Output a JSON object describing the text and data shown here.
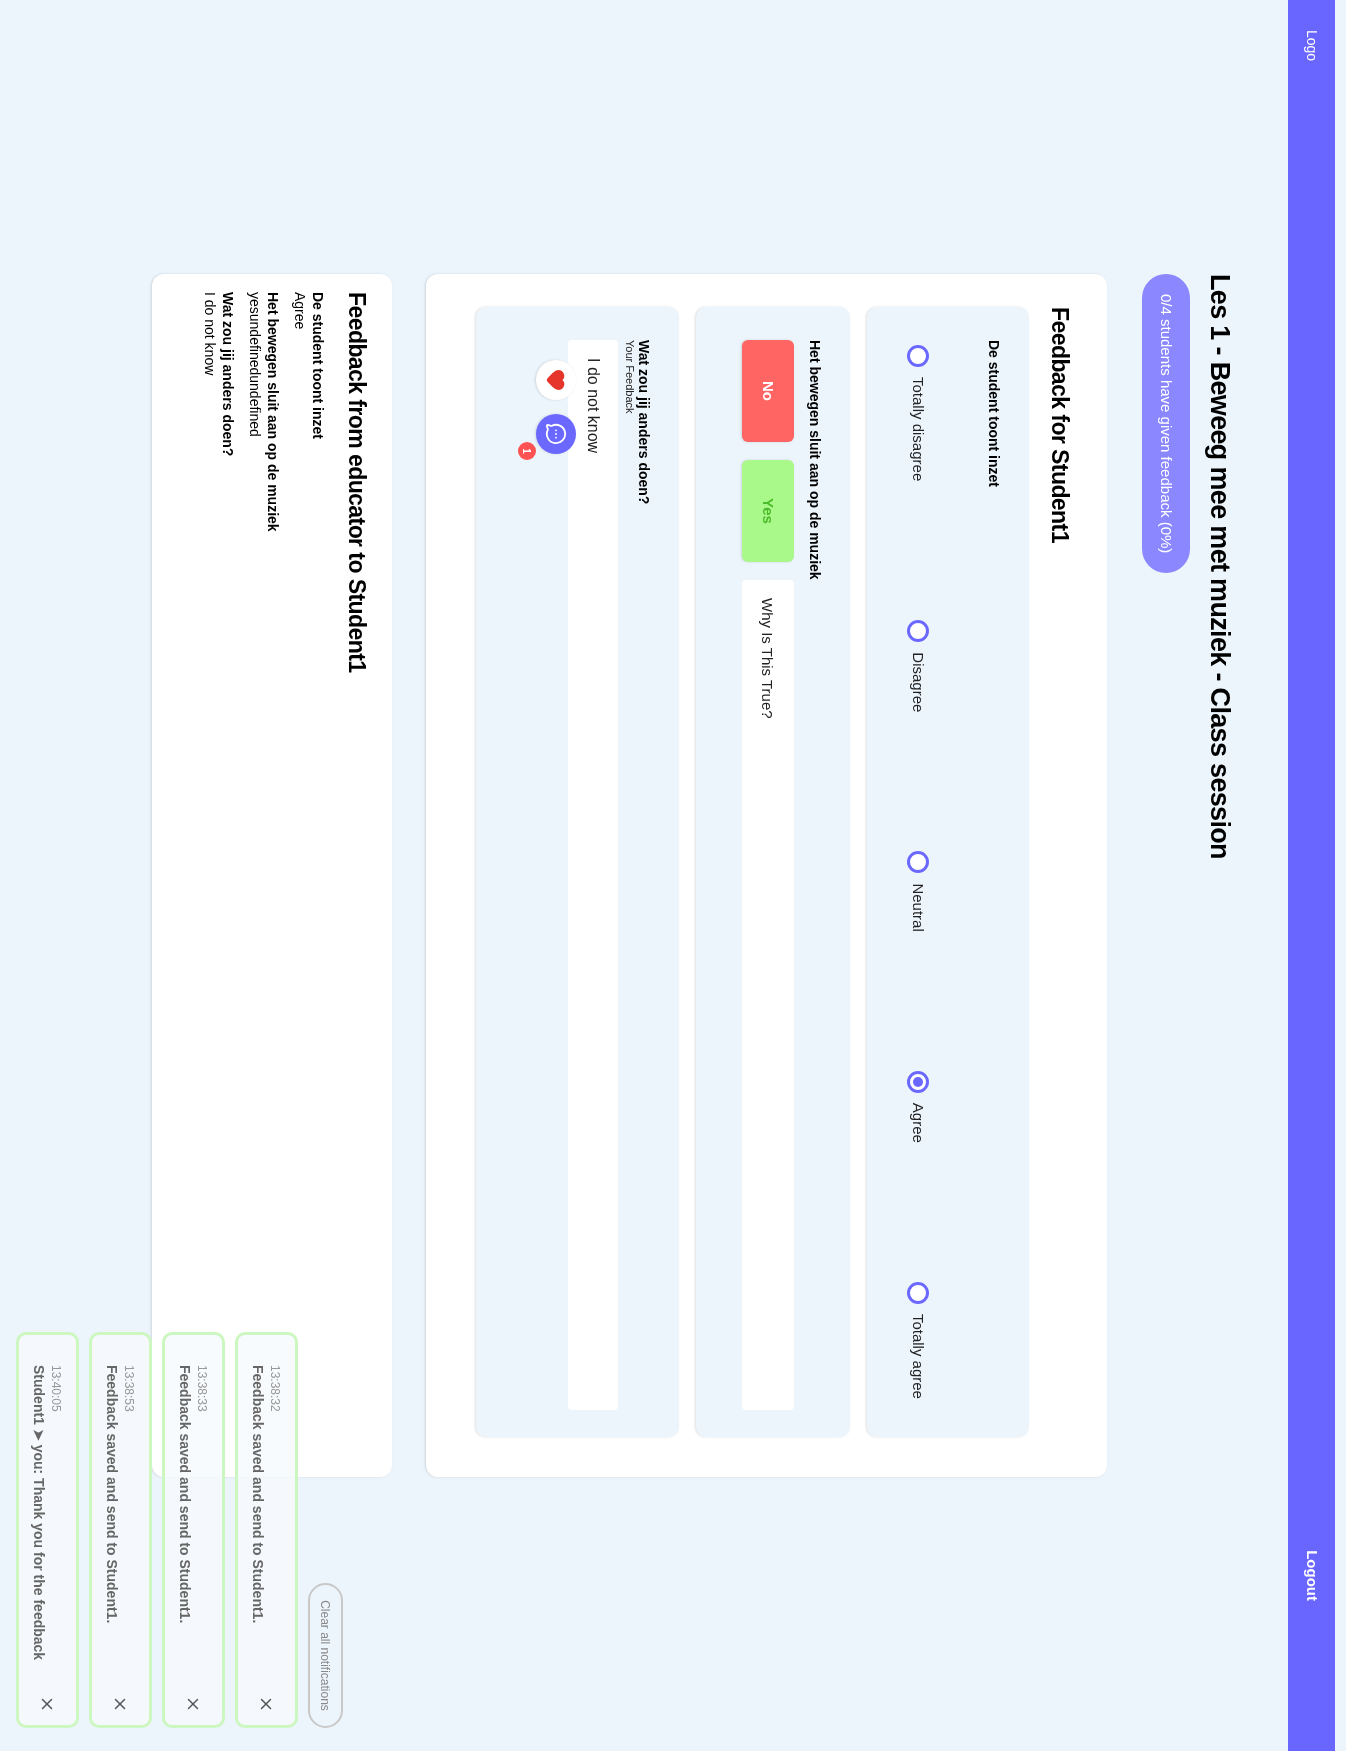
{
  "navbar": {
    "logo": "Logo",
    "logout": "Logout"
  },
  "title": "Les 1 - Beweeg mee met muziek - Class session",
  "progress_badge": "0/4 students have given feedback (0%)",
  "feedback_form": {
    "title": "Feedback for Student1",
    "questions": [
      {
        "kind": "scale",
        "label": "De student toont inzet",
        "options": [
          {
            "label": "Totally disagree",
            "selected": false
          },
          {
            "label": "Disagree",
            "selected": false
          },
          {
            "label": "Neutral",
            "selected": false
          },
          {
            "label": "Agree",
            "selected": true
          },
          {
            "label": "Totally agree",
            "selected": false
          }
        ]
      },
      {
        "kind": "yes_no",
        "label": "Het bewegen sluit aan op de muziek",
        "buttons": [
          {
            "label": "No",
            "kind": "negative"
          },
          {
            "label": "Yes",
            "kind": "positive"
          }
        ],
        "reason": {
          "placeholder": "Why Is This True?"
        }
      },
      {
        "kind": "open",
        "label": "Wat zou jij anders doen?",
        "hint": "Your Feedback",
        "value": "I do not know",
        "comment_count": "1"
      }
    ]
  },
  "educator_feedback": {
    "title": "Feedback from educator to Student1",
    "items": [
      {
        "question": "De student toont inzet",
        "answer": "Agree"
      },
      {
        "question": "Het bewegen sluit aan op de muziek",
        "answer": "yesundefinedundefined"
      },
      {
        "question": "Wat zou jij anders doen?",
        "answer": "I do not know"
      }
    ]
  },
  "notifications": {
    "clear_button": "Clear all notifications",
    "items": [
      {
        "time": "13:38:32",
        "message": "Feedback saved and send to Student1."
      },
      {
        "time": "13:38:33",
        "message": "Feedback saved and send to Student1."
      },
      {
        "time": "13:38:53",
        "message": "Feedback saved and send to Student1."
      },
      {
        "time": "13:40:05",
        "message": "Student1 ➤ you: Thank you for the feedback"
      }
    ]
  }
}
